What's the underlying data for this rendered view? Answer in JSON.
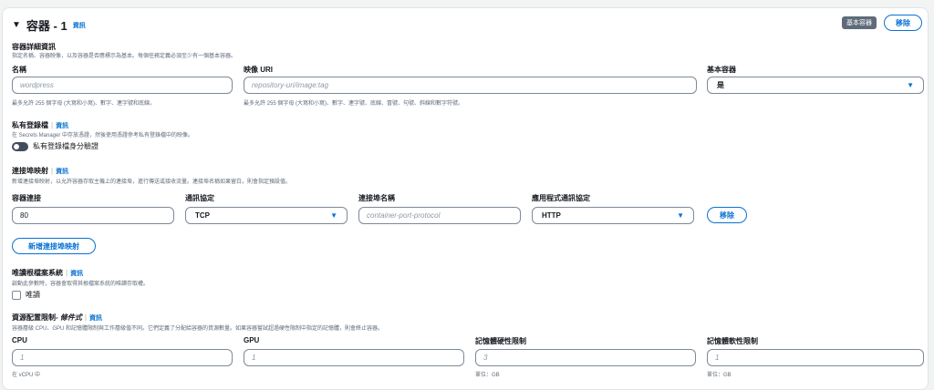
{
  "container": {
    "title": "容器 - 1",
    "info": "資訊",
    "essential_badge": "基本容器",
    "remove_label": "移除"
  },
  "details": {
    "title": "容器詳細資訊",
    "desc": "指定名稱、容器映像，以及容器是否應標示為基本。每個任務定義必須至少有一個基本容器。",
    "name_label": "名稱",
    "name_placeholder": "wordpress",
    "name_hint": "最多允許 255 個字母 (大寫和小寫)、數字、連字號和底線。",
    "image_label": "映像 URI",
    "image_placeholder": "repository-uri/image:tag",
    "image_hint": "最多允許 255 個字母 (大寫和小寫)、數字、連字號、底線、冒號、句號、斜線和數字符號。",
    "essential_label": "基本容器",
    "essential_value": "是"
  },
  "registry": {
    "title": "私有登錄檔",
    "info": "資訊",
    "desc": "在 Secrets Manager 中存放憑證，然後使用憑證參考私有登錄檔中的映像。",
    "toggle_label": "私有登錄檔身分驗證"
  },
  "ports": {
    "title": "連接埠映射",
    "info": "資訊",
    "desc": "新增連接埠映射，以允許容器存取主機上的連接埠，進行傳送或接收流量。連接埠名稱如果留白，則會指定預設值。",
    "col_port": "容器連接",
    "col_protocol": "通訊協定",
    "col_name": "連接埠名稱",
    "col_app_protocol": "應用程式通訊協定",
    "port_value": "80",
    "protocol_value": "TCP",
    "name_placeholder": "container-port-protocol",
    "app_protocol_value": "HTTP",
    "remove_label": "移除",
    "add_label": "新增連接埠映射"
  },
  "readonly": {
    "title": "唯讀根檔案系統",
    "info": "資訊",
    "desc": "啟動此參數時，容器會取得其根檔案系統的唯讀存取權。",
    "checkbox_label": "唯讀"
  },
  "resources": {
    "title": "資源配置限制",
    "title_suffix": "- 條件式",
    "info": "資訊",
    "desc": "容器層級 CPU、GPU 和記憶體限制與工作層級值不同。它們定義了分配給容器的資源數量。如果容器嘗試超過硬性限制中指定的記憶體，則會終止容器。",
    "cpu_label": "CPU",
    "cpu_placeholder": "1",
    "cpu_hint": "在 vCPU 中",
    "gpu_label": "GPU",
    "gpu_placeholder": "1",
    "mem_hard_label": "記憶體硬性限制",
    "mem_hard_placeholder": "3",
    "mem_hard_hint": "單位：GB",
    "mem_soft_label": "記憶體軟性限制",
    "mem_soft_placeholder": "1",
    "mem_soft_hint": "單位：GB"
  },
  "icons": {
    "collapse": "caret-down-icon",
    "select_caret": "caret-down-icon",
    "toggle": "toggle-switch"
  }
}
